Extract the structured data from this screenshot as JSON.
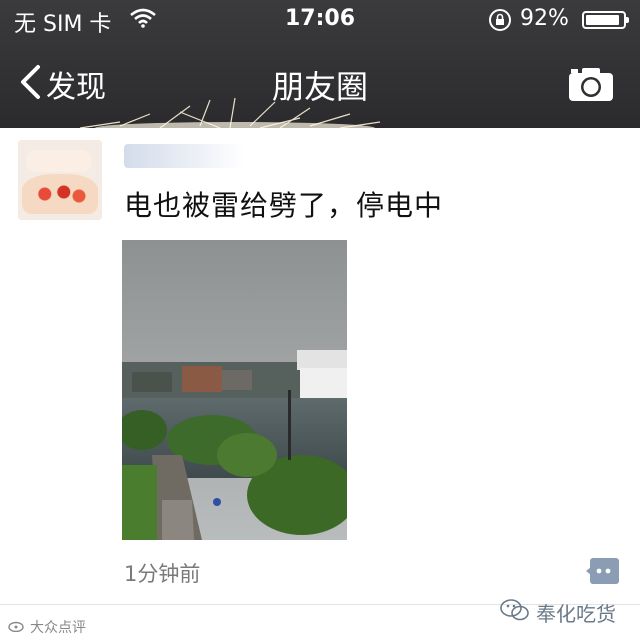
{
  "status_bar": {
    "carrier": "无 SIM 卡",
    "time": "17:06",
    "battery_percent": "92%",
    "battery_level": 0.92,
    "icons": [
      "wifi-icon",
      "orientation-lock-icon",
      "battery-icon"
    ]
  },
  "nav": {
    "back_label": "发现",
    "title": "朋友圈",
    "icons": [
      "chevron-left-icon",
      "camera-icon"
    ]
  },
  "post": {
    "text": "电也被雷给劈了，停电中",
    "timestamp": "1分钟前",
    "icons": [
      "avatar",
      "comment-icon"
    ]
  },
  "watermark": {
    "left": "大众点评",
    "right": "奉化吃货"
  },
  "colors": {
    "nav_background": "#2f2f32",
    "nav_text": "#ffffff",
    "comment_button": "#8a9db5",
    "timestamp": "#7a7a7a"
  }
}
